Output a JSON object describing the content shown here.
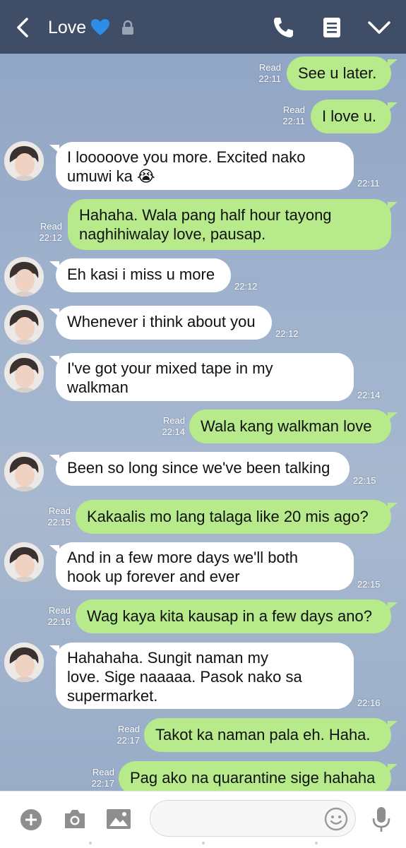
{
  "header": {
    "title": "Love",
    "title_emoji": "blue-heart",
    "icons": [
      "back-arrow",
      "blue-heart",
      "lock",
      "phone",
      "notes",
      "chevron-down"
    ]
  },
  "messages": [
    {
      "side": "out",
      "text": "See u later.",
      "read": "Read",
      "time": "22:11"
    },
    {
      "side": "out",
      "text": "I love u.",
      "read": "Read",
      "time": "22:11"
    },
    {
      "side": "in",
      "lines": [
        "I looooove you more. Excited nako",
        "umuwi ka 😭"
      ],
      "time": "22:11"
    },
    {
      "side": "out",
      "lines": [
        "Hahaha. Wala pang half hour tayong",
        "naghihiwalay love, pausap."
      ],
      "read": "Read",
      "time": "22:12"
    },
    {
      "side": "in",
      "text": "Eh kasi i miss u more",
      "time": "22:12"
    },
    {
      "side": "in",
      "text": "Whenever i think about you",
      "time": "22:12"
    },
    {
      "side": "in",
      "lines": [
        "I've got your mixed tape in my",
        "walkman"
      ],
      "time": "22:14"
    },
    {
      "side": "out",
      "text": "Wala kang walkman love",
      "read": "Read",
      "time": "22:14"
    },
    {
      "side": "in",
      "text": "Been so long since we've been talking",
      "time": "22:15"
    },
    {
      "side": "out",
      "text": "Kakaalis mo lang talaga like 20 mis ago?",
      "read": "Read",
      "time": "22:15"
    },
    {
      "side": "in",
      "lines": [
        "And in a few more days we'll both",
        "hook up forever and ever"
      ],
      "time": "22:15"
    },
    {
      "side": "out",
      "text": "Wag kaya kita kausap in a few days ano?",
      "read": "Read",
      "time": "22:16"
    },
    {
      "side": "in",
      "lines": [
        "Hahahaha. Sungit naman my",
        "love. Sige naaaaa. Pasok nako sa",
        "supermarket."
      ],
      "time": "22:16"
    },
    {
      "side": "out",
      "text": "Takot ka naman pala eh. Haha.",
      "read": "Read",
      "time": "22:17"
    },
    {
      "side": "out",
      "text": "Pag ako na quarantine sige hahaha",
      "read": "Read",
      "time": "22:17"
    }
  ],
  "input_bar": {
    "icons": [
      "plus-icon",
      "camera-icon",
      "image-icon",
      "emoji-icon",
      "microphone-icon"
    ],
    "placeholder": ""
  },
  "colors": {
    "header_bg": "#3f4d66",
    "outgoing_bubble": "#b6ea8a",
    "incoming_bubble": "#ffffff",
    "chat_bg": "#9fb2cd"
  }
}
